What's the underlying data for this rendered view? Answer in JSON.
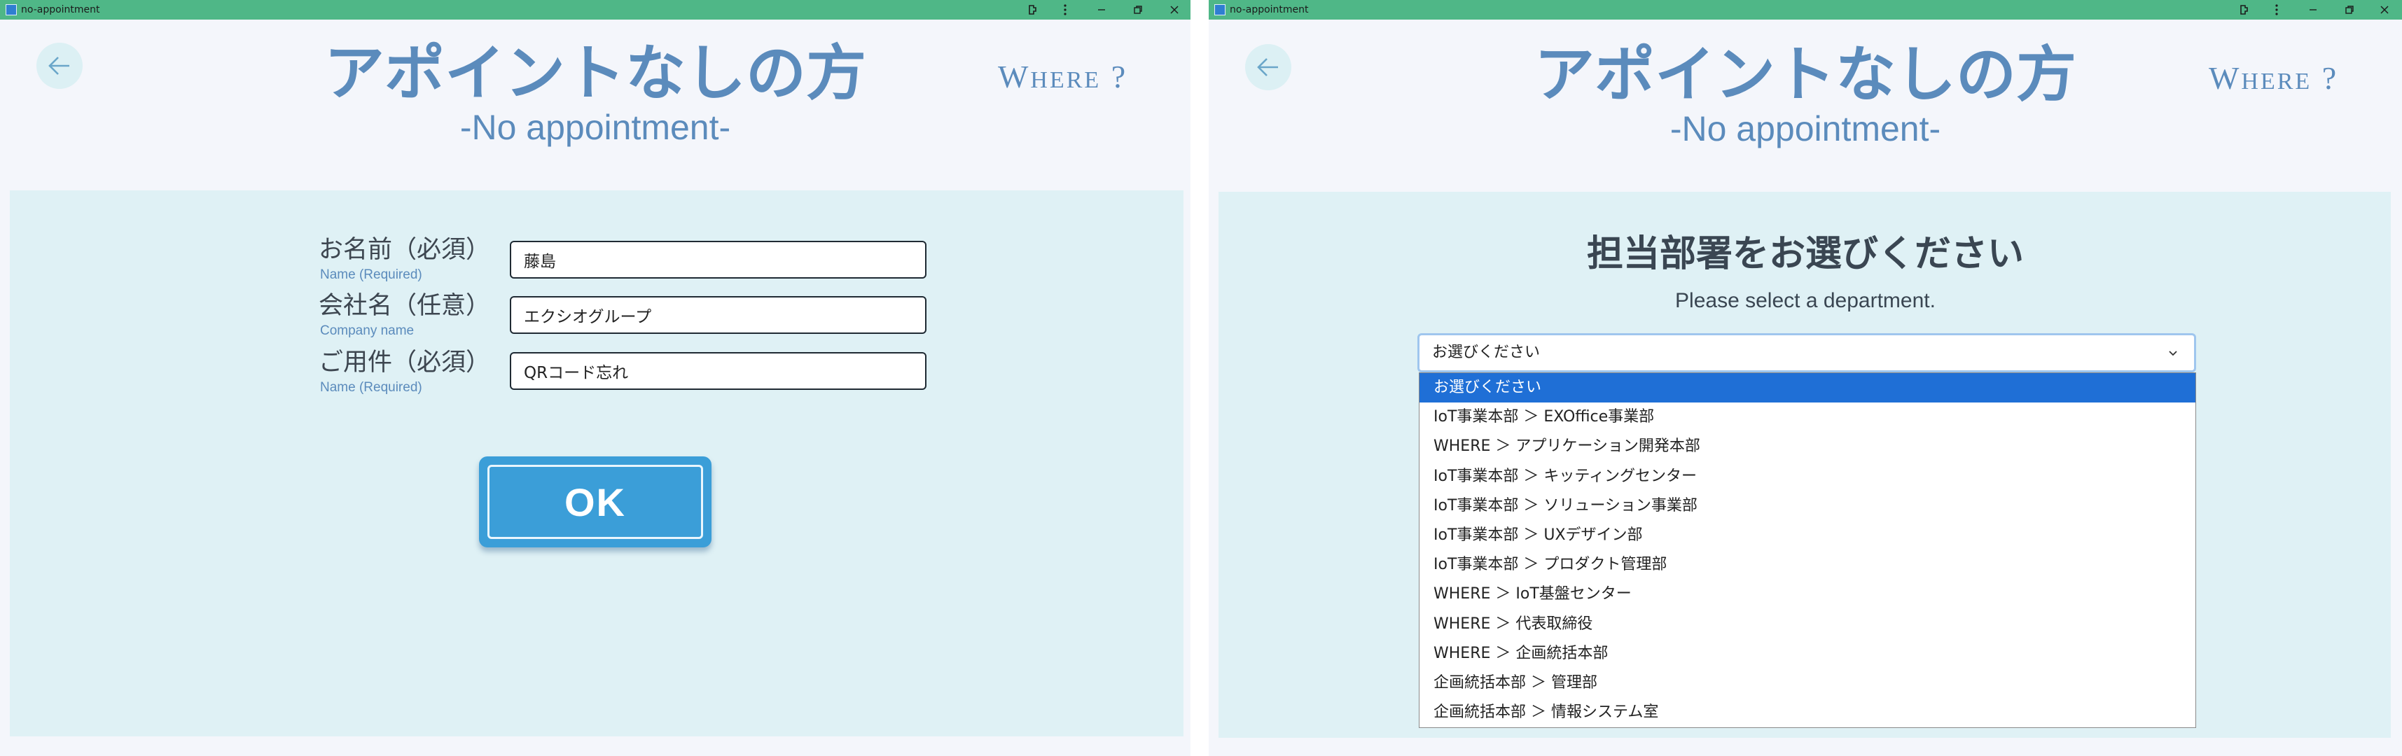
{
  "colors": {
    "titlebar": "#4fb787",
    "accent": "#5b8bbc",
    "panel": "#dff1f5",
    "ok_button": "#3b9ed8",
    "selected_option": "#1f6fd6"
  },
  "left": {
    "window_title": "no-appointment",
    "header": {
      "title": "アポイントなしの方",
      "subtitle": "-No appointment-",
      "brand": {
        "first": "W",
        "rest": "HERE",
        "mark": " ?"
      },
      "back_icon": "arrow-left-icon"
    },
    "form": {
      "fields": [
        {
          "label": "お名前（必須）",
          "sub": "Name (Required)",
          "value": "藤島"
        },
        {
          "label": "会社名（任意）",
          "sub": "Company name",
          "value": "エクシオグループ"
        },
        {
          "label": "ご用件（必須）",
          "sub": "Name (Required)",
          "value": "QRコード忘れ"
        }
      ],
      "ok_label": "OK"
    }
  },
  "right": {
    "window_title": "no-appointment",
    "header": {
      "title": "アポイントなしの方",
      "subtitle": "-No appointment-",
      "brand": {
        "first": "W",
        "rest": "HERE",
        "mark": " ?"
      }
    },
    "department": {
      "heading": "担当部署をお選びください",
      "sub": "Please select a department.",
      "selected": "お選びください",
      "options": [
        "お選びください",
        "IoT事業本部 ＞ EXOffice事業部",
        "WHERE ＞ アプリケーション開発本部",
        "IoT事業本部 ＞ キッティングセンター",
        "IoT事業本部 ＞ ソリューション事業部",
        "IoT事業本部 ＞ UXデザイン部",
        "IoT事業本部 ＞ プロダクト管理部",
        "WHERE ＞ IoT基盤センター",
        "WHERE ＞ 代表取締役",
        "WHERE ＞ 企画統括本部",
        "企画統括本部 ＞ 管理部",
        "企画統括本部 ＞ 情報システム室"
      ]
    }
  }
}
